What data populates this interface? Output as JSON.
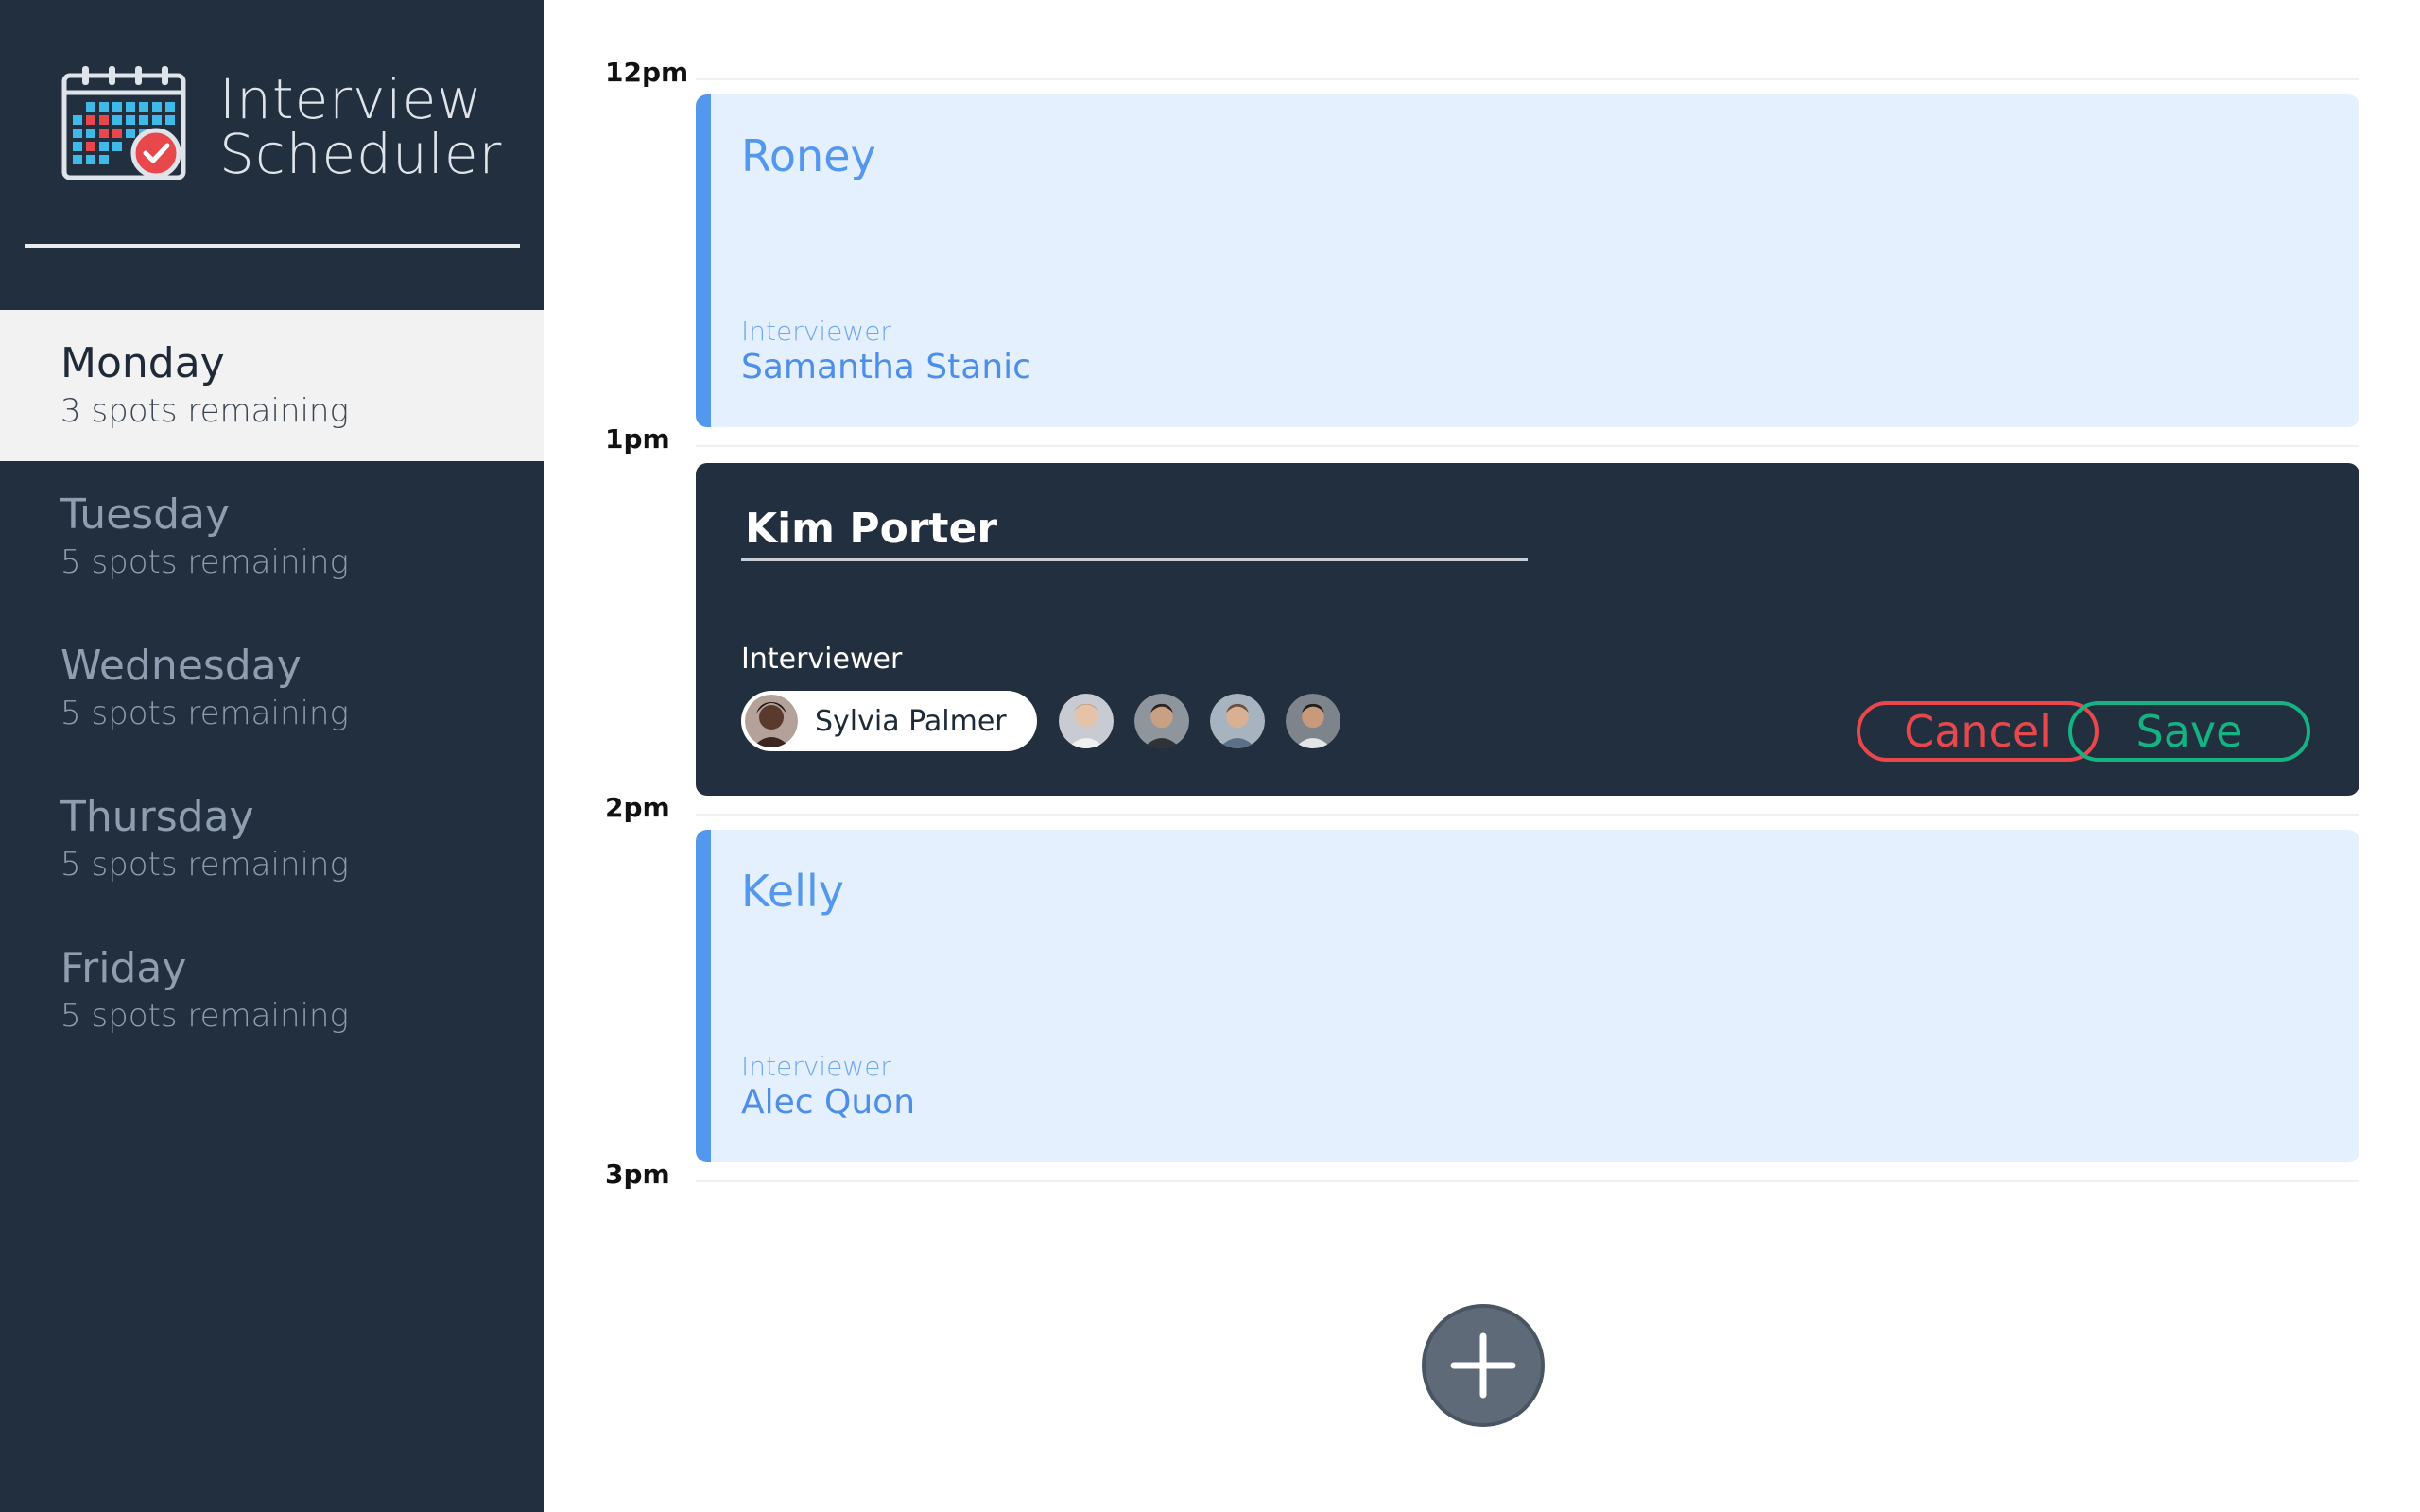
{
  "sidebar": {
    "brand": {
      "title_line1": "Interview",
      "title_line2": "Scheduler",
      "logo_icon": "calendar-check-icon"
    },
    "days": [
      {
        "name": "Monday",
        "spots": "3 spots remaining",
        "selected": true
      },
      {
        "name": "Tuesday",
        "spots": "5 spots remaining",
        "selected": false
      },
      {
        "name": "Wednesday",
        "spots": "5 spots remaining",
        "selected": false
      },
      {
        "name": "Thursday",
        "spots": "5 spots remaining",
        "selected": false
      },
      {
        "name": "Friday",
        "spots": "5 spots remaining",
        "selected": false
      }
    ]
  },
  "schedule": {
    "times": [
      "12pm",
      "1pm",
      "2pm",
      "3pm"
    ],
    "appointments": [
      {
        "student": "Roney",
        "interviewer_label": "Interviewer",
        "interviewer": "Samantha Stanic"
      },
      {
        "editing": true,
        "student_value": "Kim Porter",
        "interviewer_label": "Interviewer",
        "selected_interviewer": "Sylvia Palmer",
        "cancel_label": "Cancel",
        "save_label": "Save"
      },
      {
        "student": "Kelly",
        "interviewer_label": "Interviewer",
        "interviewer": "Alec Quon"
      }
    ],
    "add_icon": "plus-icon"
  },
  "colors": {
    "sidebar_bg": "#222f3e",
    "booked_bg": "#e4f0fe",
    "booked_accent": "#5498ee",
    "cancel": "#e8484c",
    "save": "#14b383"
  }
}
